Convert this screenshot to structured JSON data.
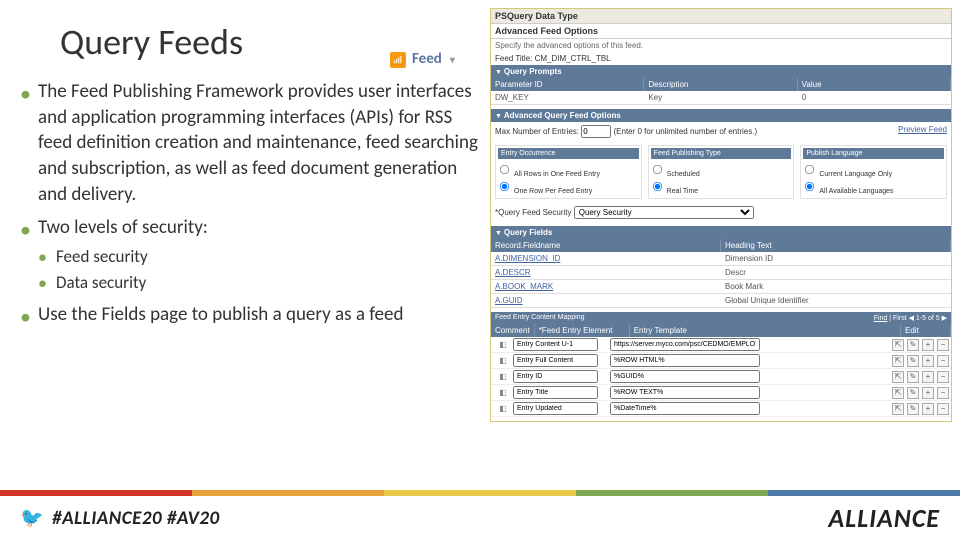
{
  "title": "Query Feeds",
  "feed_label": "Feed",
  "bullets": {
    "b1": "The Feed Publishing Framework provides user interfaces and application programming interfaces (APIs) for RSS feed definition creation and maintenance, feed searching and subscription, as well as feed document generation and delivery.",
    "b2": "Two levels of security:",
    "b2a": "Feed security",
    "b2b": "Data security",
    "b3": "Use the Fields page to publish a query as a feed"
  },
  "panel": {
    "datatype": "PSQuery Data Type",
    "afo": "Advanced Feed Options",
    "afo_sub": "Specify the advanced options of this feed.",
    "ft_label": "Feed Title:",
    "ft_value": "CM_DIM_CTRL_TBL",
    "qp": "Query Prompts",
    "qp_h1": "Parameter ID",
    "qp_h2": "Description",
    "qp_h3": "Value",
    "qp_r1": "DW_KEY",
    "qp_r2": "Key",
    "qp_r3": "0",
    "aqfo": "Advanced Query Feed Options",
    "max_label": "Max Number of Entries:",
    "max_val": "0",
    "max_hint": "(Enter 0 for unlimited number of entries.)",
    "preview": "Preview Feed",
    "col1": "Entry Occurrence",
    "col2": "Feed Publishing Type",
    "col3": "Publish Language",
    "o1a": "All Rows in One Feed Entry",
    "o1b": "One Row Per Feed Entry",
    "o2a": "Scheduled",
    "o2b": "Real Time",
    "o3a": "Current Language Only",
    "o3b": "All Available Languages",
    "qfs_label": "*Query Feed Security",
    "qfs_val": "Query Security",
    "qf": "Query Fields",
    "qf_h1": "Record.Fieldname",
    "qf_h2": "Heading Text",
    "qfr": [
      [
        "A.DIMENSION_ID",
        "Dimension ID"
      ],
      [
        "A.DESCR",
        "Descr"
      ],
      [
        "A.BOOK_MARK",
        "Book Mark"
      ],
      [
        "A.GUID",
        "Global Unique Identifier"
      ]
    ],
    "map_title": "Feed Entry Content Mapping",
    "map_find": "Find",
    "map_page": "1-5 of 5",
    "map_h1": "Comment",
    "map_h2": "*Feed Entry Element",
    "map_h3": "Entry Template",
    "map_h4": "Edit",
    "rows": [
      [
        "Entry Content U-1",
        "https://server.myco.com/psc/CEDMO/EMPLOYEE/"
      ],
      [
        "Entry Full Content",
        "%ROW HTML%"
      ],
      [
        "Entry ID",
        "%GUID%"
      ],
      [
        "Entry Title",
        "%ROW TEXT%"
      ],
      [
        "Entry Updated",
        "%DateTime%"
      ]
    ]
  },
  "hashtags": "#ALLIANCE20 #AV20",
  "logo": "ALLIANCE"
}
